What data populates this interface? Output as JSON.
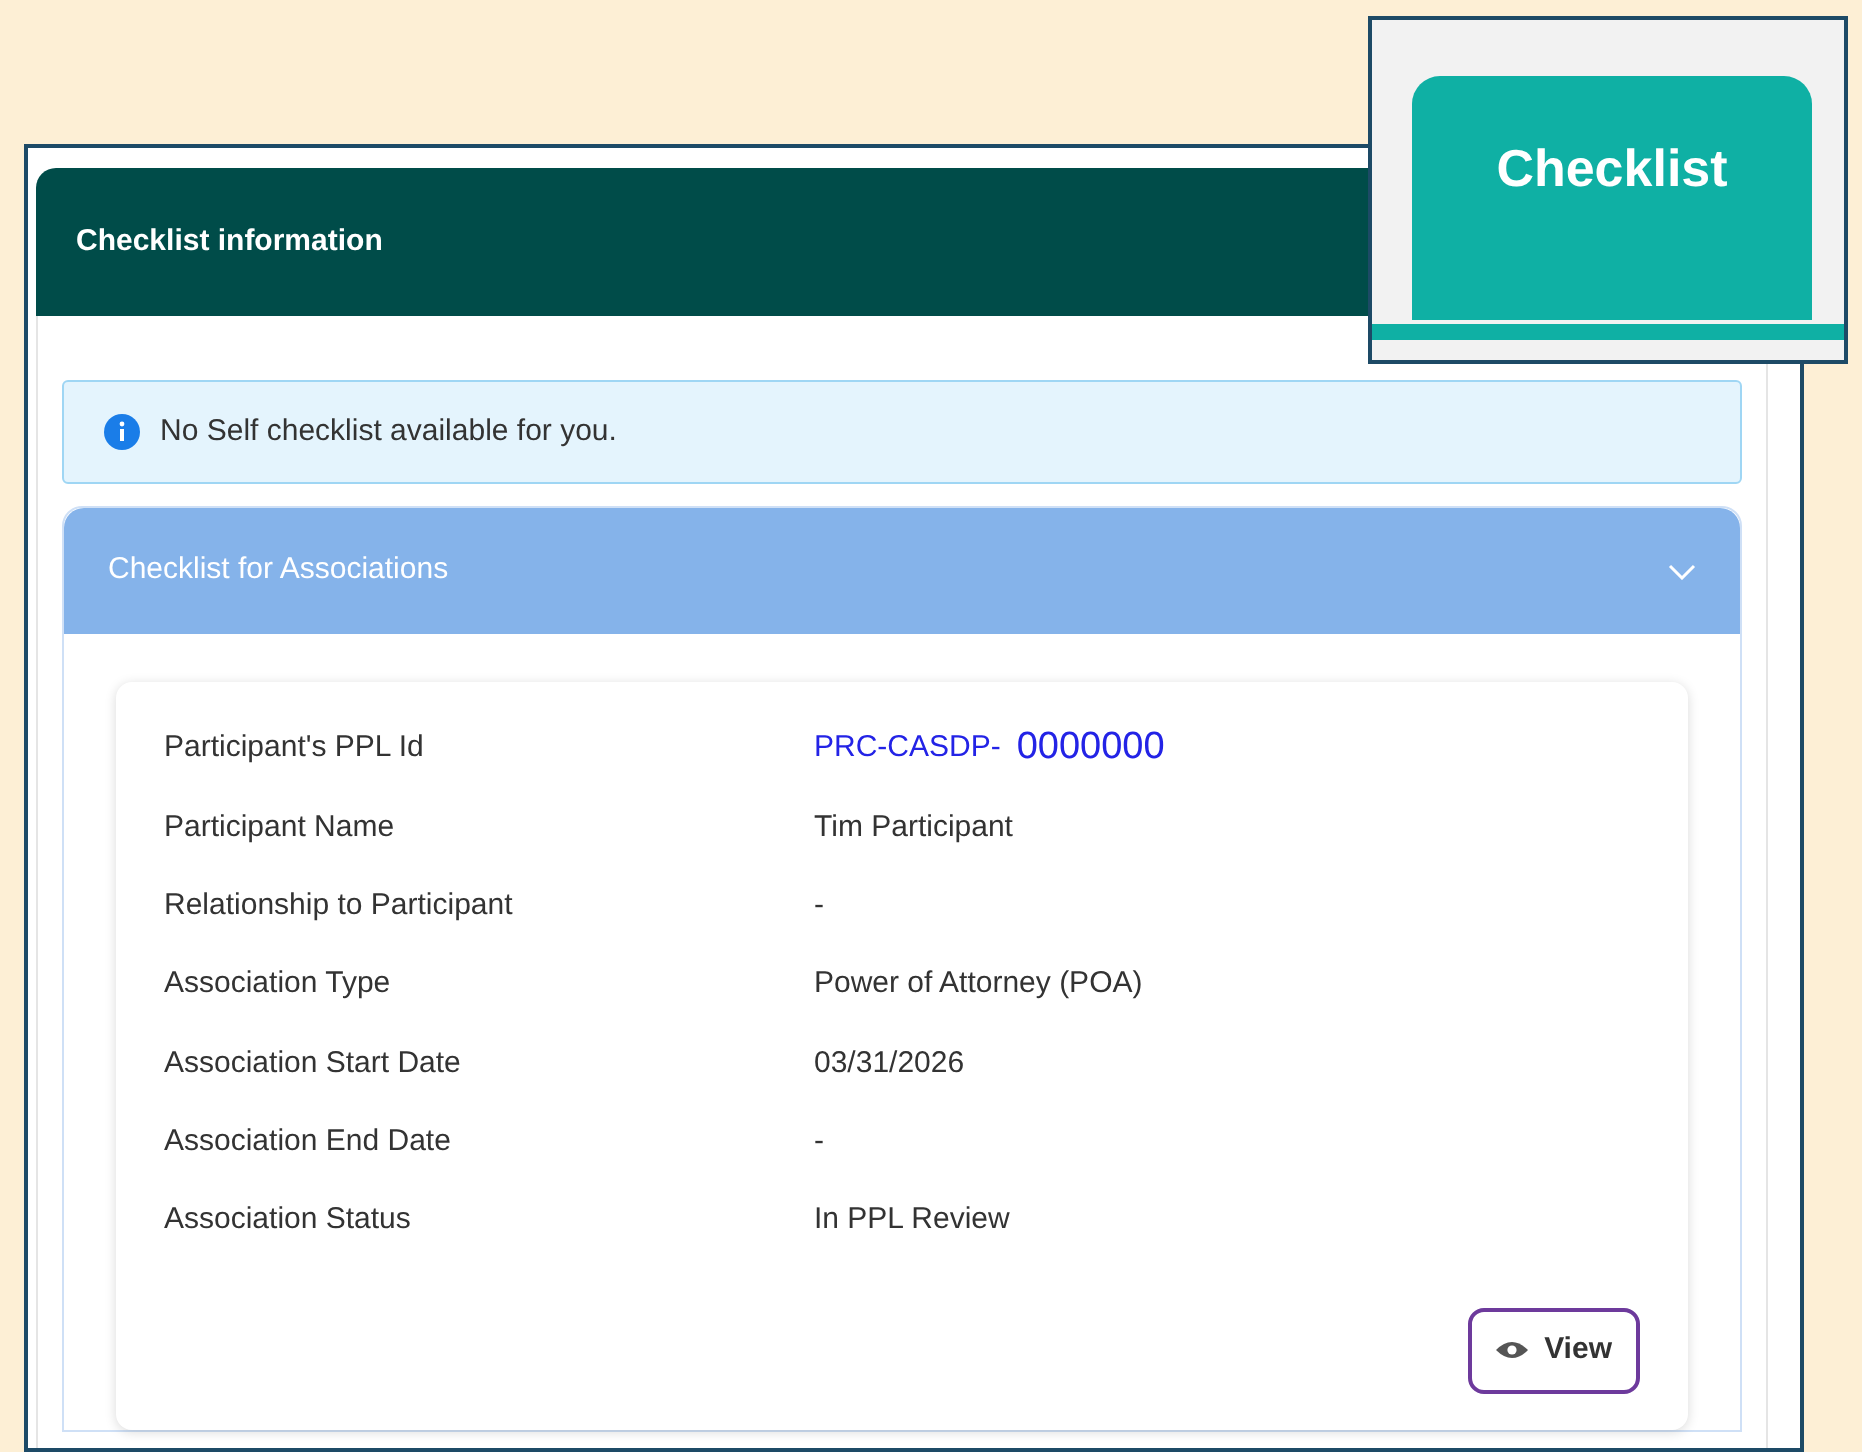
{
  "card_title": "Checklist information",
  "alert": {
    "text": "No Self checklist available for you."
  },
  "accordion": {
    "title": "Checklist for Associations",
    "expanded": true,
    "fields": [
      {
        "label": "Participant's PPL Id",
        "kind": "id",
        "prefix": "PRC-CASDP-",
        "value": "0000000"
      },
      {
        "label": "Participant Name",
        "kind": "text",
        "value": "Tim Participant"
      },
      {
        "label": "Relationship to Participant",
        "kind": "text",
        "value": "-"
      },
      {
        "label": "Association Type",
        "kind": "text",
        "value": "Power of Attorney (POA)"
      },
      {
        "label": "Association Start Date",
        "kind": "text",
        "value": "03/31/2026"
      },
      {
        "label": "Association End Date",
        "kind": "text",
        "value": "-"
      },
      {
        "label": "Association Status",
        "kind": "text",
        "value": "In PPL Review"
      }
    ],
    "button": "View"
  },
  "callout": {
    "tab": "Checklist",
    "selected": true
  }
}
